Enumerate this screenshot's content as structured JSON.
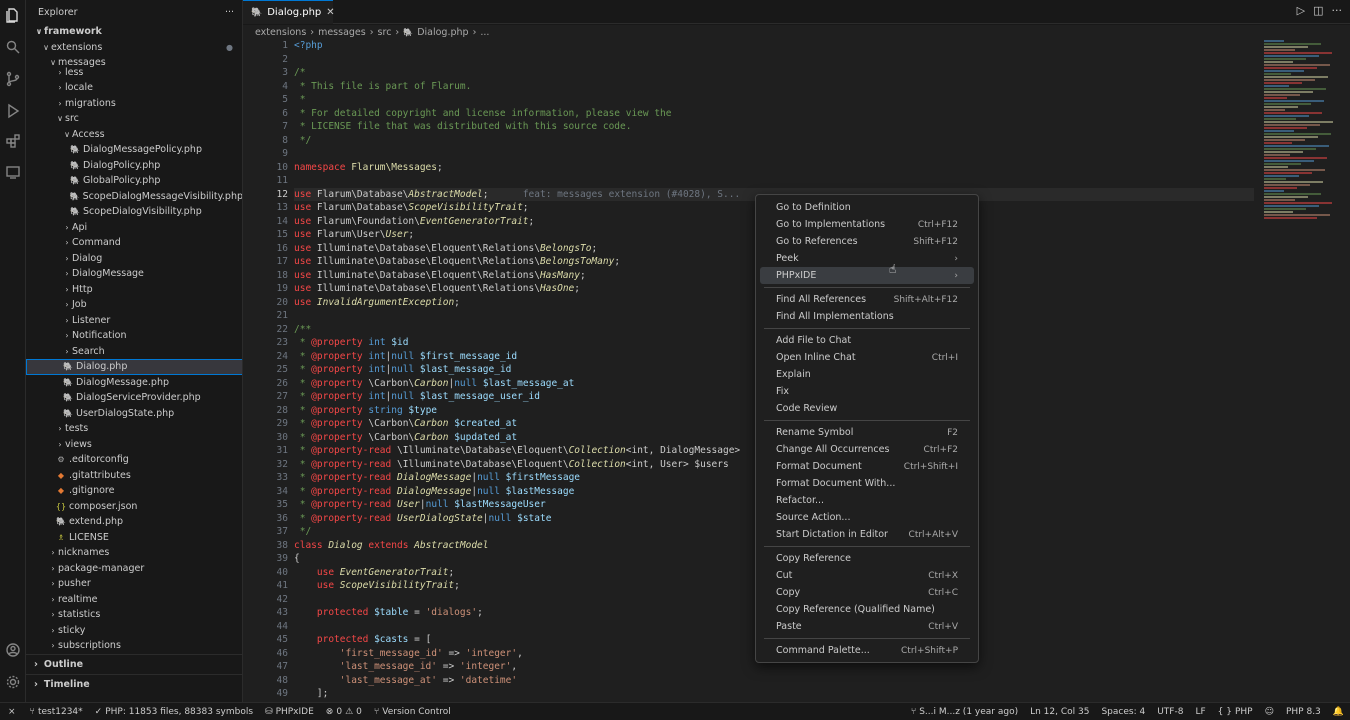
{
  "explorer": {
    "title": "Explorer",
    "more": "···"
  },
  "tree": [
    {
      "label": "framework",
      "depth": 0,
      "chev": "∨",
      "bold": true
    },
    {
      "label": "extensions",
      "depth": 1,
      "chev": "∨",
      "dot": true
    },
    {
      "label": "messages",
      "depth": 2,
      "chev": "∨"
    },
    {
      "label": "less",
      "depth": 3,
      "chev": "›"
    },
    {
      "label": "locale",
      "depth": 3,
      "chev": "›"
    },
    {
      "label": "migrations",
      "depth": 3,
      "chev": "›"
    },
    {
      "label": "src",
      "depth": 3,
      "chev": "∨"
    },
    {
      "label": "Access",
      "depth": 4,
      "chev": "∨"
    },
    {
      "label": "DialogMessagePolicy.php",
      "depth": 5,
      "icon": "php"
    },
    {
      "label": "DialogPolicy.php",
      "depth": 5,
      "icon": "php"
    },
    {
      "label": "GlobalPolicy.php",
      "depth": 5,
      "icon": "php"
    },
    {
      "label": "ScopeDialogMessageVisibility.php",
      "depth": 5,
      "icon": "php"
    },
    {
      "label": "ScopeDialogVisibility.php",
      "depth": 5,
      "icon": "php"
    },
    {
      "label": "Api",
      "depth": 4,
      "chev": "›"
    },
    {
      "label": "Command",
      "depth": 4,
      "chev": "›"
    },
    {
      "label": "Dialog",
      "depth": 4,
      "chev": "›"
    },
    {
      "label": "DialogMessage",
      "depth": 4,
      "chev": "›"
    },
    {
      "label": "Http",
      "depth": 4,
      "chev": "›"
    },
    {
      "label": "Job",
      "depth": 4,
      "chev": "›"
    },
    {
      "label": "Listener",
      "depth": 4,
      "chev": "›"
    },
    {
      "label": "Notification",
      "depth": 4,
      "chev": "›"
    },
    {
      "label": "Search",
      "depth": 4,
      "chev": "›"
    },
    {
      "label": "Dialog.php",
      "depth": 4,
      "icon": "php",
      "selected": true
    },
    {
      "label": "DialogMessage.php",
      "depth": 4,
      "icon": "php"
    },
    {
      "label": "DialogServiceProvider.php",
      "depth": 4,
      "icon": "php"
    },
    {
      "label": "UserDialogState.php",
      "depth": 4,
      "icon": "php"
    },
    {
      "label": "tests",
      "depth": 3,
      "chev": "›"
    },
    {
      "label": "views",
      "depth": 3,
      "chev": "›"
    },
    {
      "label": ".editorconfig",
      "depth": 3,
      "icon": "gear"
    },
    {
      "label": ".gitattributes",
      "depth": 3,
      "icon": "git"
    },
    {
      "label": ".gitignore",
      "depth": 3,
      "icon": "git"
    },
    {
      "label": "composer.json",
      "depth": 3,
      "icon": "json"
    },
    {
      "label": "extend.php",
      "depth": 3,
      "icon": "php"
    },
    {
      "label": "LICENSE",
      "depth": 3,
      "icon": "license"
    },
    {
      "label": "nicknames",
      "depth": 2,
      "chev": "›"
    },
    {
      "label": "package-manager",
      "depth": 2,
      "chev": "›"
    },
    {
      "label": "pusher",
      "depth": 2,
      "chev": "›"
    },
    {
      "label": "realtime",
      "depth": 2,
      "chev": "›"
    },
    {
      "label": "statistics",
      "depth": 2,
      "chev": "›"
    },
    {
      "label": "sticky",
      "depth": 2,
      "chev": "›"
    },
    {
      "label": "subscriptions",
      "depth": 2,
      "chev": "›"
    }
  ],
  "panels": {
    "outline": "Outline",
    "timeline": "Timeline"
  },
  "tab": {
    "label": "Dialog.php"
  },
  "breadcrumbs": [
    "extensions",
    "messages",
    "src",
    "Dialog.php",
    "..."
  ],
  "editor": {
    "current_line": 12,
    "lines": [
      [
        [
          "<?php",
          "#569cd6"
        ]
      ],
      [],
      [
        [
          "/*",
          "#6a9955"
        ]
      ],
      [
        [
          " * This file is part of Flarum.",
          "#6a9955"
        ]
      ],
      [
        [
          " *",
          "#6a9955"
        ]
      ],
      [
        [
          " * For detailed copyright and license information, please view the",
          "#6a9955"
        ]
      ],
      [
        [
          " * LICENSE file that was distributed with this source code.",
          "#6a9955"
        ]
      ],
      [
        [
          " */",
          "#6a9955"
        ]
      ],
      [],
      [
        [
          "namespace ",
          "#f44747"
        ],
        [
          "Flarum\\Messages",
          "#dcdcaa"
        ],
        [
          ";",
          "#cccccc"
        ]
      ],
      [],
      [
        [
          "use ",
          "#f44747"
        ],
        [
          "Flarum\\Database\\",
          "#cccccc"
        ],
        [
          "AbstractModel",
          "#dcdcaa"
        ],
        [
          ";",
          "#cccccc"
        ],
        [
          "      feat: messages extension (#4028), S...",
          "#6e7681"
        ]
      ],
      [
        [
          "use ",
          "#f44747"
        ],
        [
          "Flarum\\Database\\",
          "#cccccc"
        ],
        [
          "ScopeVisibilityTrait",
          "#dcdcaa"
        ],
        [
          ";",
          "#cccccc"
        ]
      ],
      [
        [
          "use ",
          "#f44747"
        ],
        [
          "Flarum\\Foundation\\",
          "#cccccc"
        ],
        [
          "EventGeneratorTrait",
          "#dcdcaa"
        ],
        [
          ";",
          "#cccccc"
        ]
      ],
      [
        [
          "use ",
          "#f44747"
        ],
        [
          "Flarum\\User\\",
          "#cccccc"
        ],
        [
          "User",
          "#dcdcaa"
        ],
        [
          ";",
          "#cccccc"
        ]
      ],
      [
        [
          "use ",
          "#f44747"
        ],
        [
          "Illuminate\\Database\\Eloquent\\Relations\\",
          "#cccccc"
        ],
        [
          "BelongsTo",
          "#dcdcaa"
        ],
        [
          ";",
          "#cccccc"
        ]
      ],
      [
        [
          "use ",
          "#f44747"
        ],
        [
          "Illuminate\\Database\\Eloquent\\Relations\\",
          "#cccccc"
        ],
        [
          "BelongsToMany",
          "#dcdcaa"
        ],
        [
          ";",
          "#cccccc"
        ]
      ],
      [
        [
          "use ",
          "#f44747"
        ],
        [
          "Illuminate\\Database\\Eloquent\\Relations\\",
          "#cccccc"
        ],
        [
          "HasMany",
          "#dcdcaa"
        ],
        [
          ";",
          "#cccccc"
        ]
      ],
      [
        [
          "use ",
          "#f44747"
        ],
        [
          "Illuminate\\Database\\Eloquent\\Relations\\",
          "#cccccc"
        ],
        [
          "HasOne",
          "#dcdcaa"
        ],
        [
          ";",
          "#cccccc"
        ]
      ],
      [
        [
          "use ",
          "#f44747"
        ],
        [
          "InvalidArgumentException",
          "#dcdcaa"
        ],
        [
          ";",
          "#cccccc"
        ]
      ],
      [],
      [
        [
          "/**",
          "#6a9955"
        ]
      ],
      [
        [
          " * ",
          "#6a9955"
        ],
        [
          "@property ",
          "#f44747"
        ],
        [
          "int ",
          "#569cd6"
        ],
        [
          "$id",
          "#9cdcfe"
        ]
      ],
      [
        [
          " * ",
          "#6a9955"
        ],
        [
          "@property ",
          "#f44747"
        ],
        [
          "int",
          "#569cd6"
        ],
        [
          "|",
          "#cccccc"
        ],
        [
          "null ",
          "#569cd6"
        ],
        [
          "$first_message_id",
          "#9cdcfe"
        ]
      ],
      [
        [
          " * ",
          "#6a9955"
        ],
        [
          "@property ",
          "#f44747"
        ],
        [
          "int",
          "#569cd6"
        ],
        [
          "|",
          "#cccccc"
        ],
        [
          "null ",
          "#569cd6"
        ],
        [
          "$last_message_id",
          "#9cdcfe"
        ]
      ],
      [
        [
          " * ",
          "#6a9955"
        ],
        [
          "@property ",
          "#f44747"
        ],
        [
          "\\Carbon\\",
          "#cccccc"
        ],
        [
          "Carbon",
          "#dcdcaa"
        ],
        [
          "|",
          "#cccccc"
        ],
        [
          "null ",
          "#569cd6"
        ],
        [
          "$last_message_at",
          "#9cdcfe"
        ]
      ],
      [
        [
          " * ",
          "#6a9955"
        ],
        [
          "@property ",
          "#f44747"
        ],
        [
          "int",
          "#569cd6"
        ],
        [
          "|",
          "#cccccc"
        ],
        [
          "null ",
          "#569cd6"
        ],
        [
          "$last_message_user_id",
          "#9cdcfe"
        ]
      ],
      [
        [
          " * ",
          "#6a9955"
        ],
        [
          "@property ",
          "#f44747"
        ],
        [
          "string ",
          "#569cd6"
        ],
        [
          "$type",
          "#9cdcfe"
        ]
      ],
      [
        [
          " * ",
          "#6a9955"
        ],
        [
          "@property ",
          "#f44747"
        ],
        [
          "\\Carbon\\",
          "#cccccc"
        ],
        [
          "Carbon ",
          "#dcdcaa"
        ],
        [
          "$created_at",
          "#9cdcfe"
        ]
      ],
      [
        [
          " * ",
          "#6a9955"
        ],
        [
          "@property ",
          "#f44747"
        ],
        [
          "\\Carbon\\",
          "#cccccc"
        ],
        [
          "Carbon ",
          "#dcdcaa"
        ],
        [
          "$updated_at",
          "#9cdcfe"
        ]
      ],
      [
        [
          " * ",
          "#6a9955"
        ],
        [
          "@property-read ",
          "#f44747"
        ],
        [
          "\\Illuminate\\Database\\Eloquent\\",
          "#cccccc"
        ],
        [
          "Collection",
          "#dcdcaa"
        ],
        [
          "<int, DialogMessage>",
          "#cccccc"
        ]
      ],
      [
        [
          " * ",
          "#6a9955"
        ],
        [
          "@property-read ",
          "#f44747"
        ],
        [
          "\\Illuminate\\Database\\Eloquent\\",
          "#cccccc"
        ],
        [
          "Collection",
          "#dcdcaa"
        ],
        [
          "<int, User> $users",
          "#cccccc"
        ]
      ],
      [
        [
          " * ",
          "#6a9955"
        ],
        [
          "@property-read ",
          "#f44747"
        ],
        [
          "DialogMessage",
          "#dcdcaa"
        ],
        [
          "|",
          "#cccccc"
        ],
        [
          "null ",
          "#569cd6"
        ],
        [
          "$firstMessage",
          "#9cdcfe"
        ]
      ],
      [
        [
          " * ",
          "#6a9955"
        ],
        [
          "@property-read ",
          "#f44747"
        ],
        [
          "DialogMessage",
          "#dcdcaa"
        ],
        [
          "|",
          "#cccccc"
        ],
        [
          "null ",
          "#569cd6"
        ],
        [
          "$lastMessage",
          "#9cdcfe"
        ]
      ],
      [
        [
          " * ",
          "#6a9955"
        ],
        [
          "@property-read ",
          "#f44747"
        ],
        [
          "User",
          "#dcdcaa"
        ],
        [
          "|",
          "#cccccc"
        ],
        [
          "null ",
          "#569cd6"
        ],
        [
          "$lastMessageUser",
          "#9cdcfe"
        ]
      ],
      [
        [
          " * ",
          "#6a9955"
        ],
        [
          "@property-read ",
          "#f44747"
        ],
        [
          "UserDialogState",
          "#dcdcaa"
        ],
        [
          "|",
          "#cccccc"
        ],
        [
          "null ",
          "#569cd6"
        ],
        [
          "$state",
          "#9cdcfe"
        ]
      ],
      [
        [
          " */",
          "#6a9955"
        ]
      ],
      [
        [
          "class ",
          "#f44747"
        ],
        [
          "Dialog ",
          "#dcdcaa"
        ],
        [
          "extends ",
          "#f44747"
        ],
        [
          "AbstractModel",
          "#dcdcaa"
        ]
      ],
      [
        [
          "{",
          "#cccccc"
        ]
      ],
      [
        [
          "    use ",
          "#f44747"
        ],
        [
          "EventGeneratorTrait",
          "#dcdcaa"
        ],
        [
          ";",
          "#cccccc"
        ]
      ],
      [
        [
          "    use ",
          "#f44747"
        ],
        [
          "ScopeVisibilityTrait",
          "#dcdcaa"
        ],
        [
          ";",
          "#cccccc"
        ]
      ],
      [],
      [
        [
          "    protected ",
          "#f44747"
        ],
        [
          "$table",
          "#9cdcfe"
        ],
        [
          " = ",
          "#cccccc"
        ],
        [
          "'dialogs'",
          "#ce9178"
        ],
        [
          ";",
          "#cccccc"
        ]
      ],
      [],
      [
        [
          "    protected ",
          "#f44747"
        ],
        [
          "$casts",
          "#9cdcfe"
        ],
        [
          " = [",
          "#cccccc"
        ]
      ],
      [
        [
          "        'first_message_id'",
          "#ce9178"
        ],
        [
          " => ",
          "#cccccc"
        ],
        [
          "'integer'",
          "#ce9178"
        ],
        [
          ",",
          "#cccccc"
        ]
      ],
      [
        [
          "        'last_message_id'",
          "#ce9178"
        ],
        [
          " => ",
          "#cccccc"
        ],
        [
          "'integer'",
          "#ce9178"
        ],
        [
          ",",
          "#cccccc"
        ]
      ],
      [
        [
          "        'last_message_at'",
          "#ce9178"
        ],
        [
          " => ",
          "#cccccc"
        ],
        [
          "'datetime'",
          "#ce9178"
        ]
      ],
      [
        [
          "    ];",
          "#cccccc"
        ]
      ]
    ]
  },
  "context_menu": [
    {
      "label": "Go to Definition",
      "shortcut": ""
    },
    {
      "label": "Go to Implementations",
      "shortcut": "Ctrl+F12"
    },
    {
      "label": "Go to References",
      "shortcut": "Shift+F12"
    },
    {
      "label": "Peek",
      "shortcut": "›"
    },
    {
      "label": "PHPxIDE",
      "shortcut": "›",
      "hover": true
    },
    {
      "sep": true
    },
    {
      "label": "Find All References",
      "shortcut": "Shift+Alt+F12"
    },
    {
      "label": "Find All Implementations",
      "shortcut": ""
    },
    {
      "sep": true
    },
    {
      "label": "Add File to Chat",
      "shortcut": ""
    },
    {
      "label": "Open Inline Chat",
      "shortcut": "Ctrl+I"
    },
    {
      "label": "Explain",
      "shortcut": ""
    },
    {
      "label": "Fix",
      "shortcut": ""
    },
    {
      "label": "Code Review",
      "shortcut": ""
    },
    {
      "sep": true
    },
    {
      "label": "Rename Symbol",
      "shortcut": "F2"
    },
    {
      "label": "Change All Occurrences",
      "shortcut": "Ctrl+F2"
    },
    {
      "label": "Format Document",
      "shortcut": "Ctrl+Shift+I"
    },
    {
      "label": "Format Document With...",
      "shortcut": ""
    },
    {
      "label": "Refactor...",
      "shortcut": ""
    },
    {
      "label": "Source Action...",
      "shortcut": ""
    },
    {
      "label": "Start Dictation in Editor",
      "shortcut": "Ctrl+Alt+V"
    },
    {
      "sep": true
    },
    {
      "label": "Copy Reference",
      "shortcut": ""
    },
    {
      "label": "Cut",
      "shortcut": "Ctrl+X"
    },
    {
      "label": "Copy",
      "shortcut": "Ctrl+C"
    },
    {
      "label": "Copy Reference (Qualified Name)",
      "shortcut": ""
    },
    {
      "label": "Paste",
      "shortcut": "Ctrl+V"
    },
    {
      "sep": true
    },
    {
      "label": "Command Palette...",
      "shortcut": "Ctrl+Shift+P"
    }
  ],
  "status": {
    "branch": "test1234*",
    "php_files": "PHP: 11853 files, 88383 symbols",
    "phpxide": "PHPxIDE",
    "problems": "0",
    "warnings": "0",
    "vcs": "Version Control",
    "blame": "S...i M...z (1 year ago)",
    "position": "Ln 12, Col 35",
    "spaces": "Spaces: 4",
    "encoding": "UTF-8",
    "eol": "LF",
    "language": "PHP",
    "php_version": "PHP 8.3"
  },
  "colors": {
    "accent": "#0078d4",
    "bg": "#1f1f1f",
    "sidebar": "#181818"
  }
}
